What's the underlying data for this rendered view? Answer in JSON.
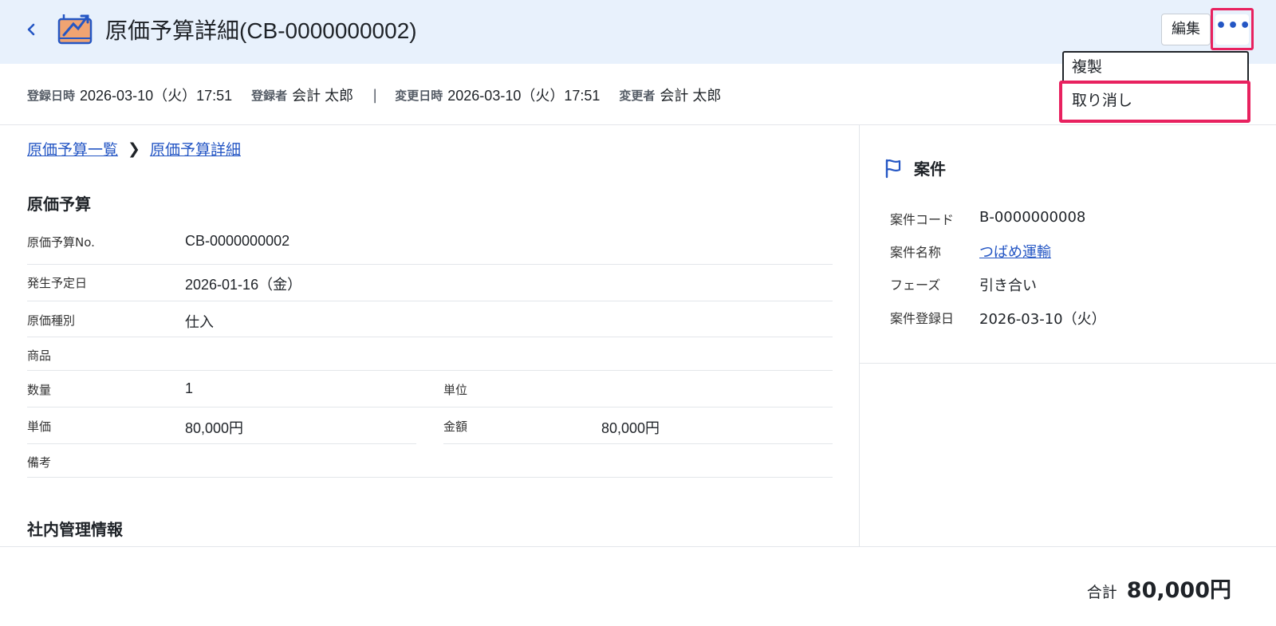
{
  "header": {
    "title": "原価予算詳細(CB-0000000002)",
    "edit_label": "編集",
    "more_label": "•••"
  },
  "meta": {
    "registered_at_label": "登録日時",
    "registered_at": "2026-03-10（火）17:51",
    "registered_by_label": "登録者",
    "registered_by": "会計 太郎",
    "separator": "|",
    "updated_at_label": "変更日時",
    "updated_at": "2026-03-10（火）17:51",
    "updated_by_label": "変更者",
    "updated_by": "会計 太郎"
  },
  "breadcrumb": {
    "items": [
      "原価予算一覧",
      "原価予算詳細"
    ],
    "separator": "❯"
  },
  "main": {
    "section_title": "原価予算",
    "fields": {
      "no_label": "原価予算No.",
      "no_value": "CB-0000000002",
      "date_label": "発生予定日",
      "date_value": "2026-01-16（金）",
      "type_label": "原価種別",
      "type_value": "仕入",
      "product_label": "商品",
      "product_value": "",
      "qty_label": "数量",
      "qty_value": "1",
      "unit_label": "単位",
      "unit_value": "",
      "price_label": "単価",
      "price_value": "80,000円",
      "amount_label": "金額",
      "amount_value": "80,000円",
      "note_label": "備考",
      "note_value": ""
    },
    "section2_title": "社内管理情報"
  },
  "side": {
    "title": "案件",
    "code_label": "案件コード",
    "code_value": "B-0000000008",
    "name_label": "案件名称",
    "name_value": "つばめ運輸",
    "phase_label": "フェーズ",
    "phase_value": "引き合い",
    "regdate_label": "案件登録日",
    "regdate_value": "2026-03-10（火）"
  },
  "footer": {
    "total_label": "合計",
    "total_value": "80,000円"
  },
  "menu": {
    "items": [
      "複製",
      "取り消し"
    ]
  },
  "colors": {
    "header_bg": "#e8f1fc",
    "link": "#2456c4",
    "highlight": "#e8215f"
  }
}
